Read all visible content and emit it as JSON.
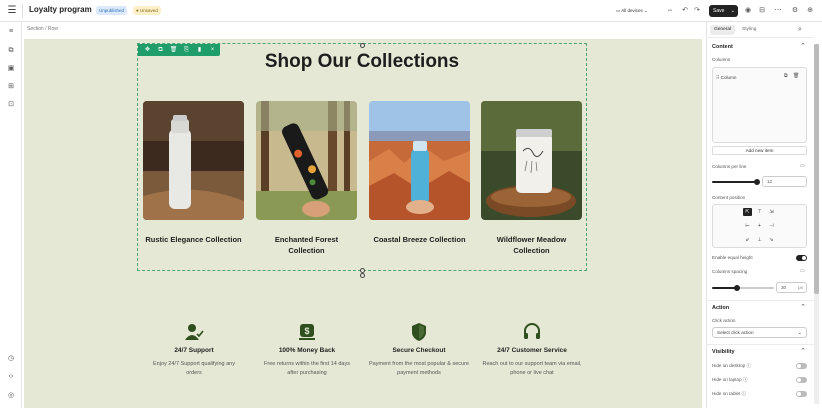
{
  "header": {
    "title": "Loyalty program",
    "status_published": "Unpublished",
    "status_saved": "Unsaved",
    "device_select": "All devices",
    "save_label": "Save"
  },
  "breadcrumb": {
    "part1": "Section",
    "sep": "/",
    "part2": "Row"
  },
  "canvas": {
    "heading": "Shop Our Collections",
    "collections": [
      {
        "title": "Rustic Elegance Collection"
      },
      {
        "title": "Enchanted Forest Collection"
      },
      {
        "title": "Coastal Breeze Collection"
      },
      {
        "title": "Wildflower Meadow Collection"
      }
    ],
    "features": [
      {
        "title": "24/7 Support",
        "desc": "Enjoy 24/7 Support qualifying any orders",
        "icon": "support-agent-icon"
      },
      {
        "title": "100% Money Back",
        "desc": "Free returns within the first 14 days after purchasing",
        "icon": "money-back-icon"
      },
      {
        "title": "Secure Checkout",
        "desc": "Payment from the most popular & secure payment methods",
        "icon": "shield-icon"
      },
      {
        "title": "24/7 Customer Service",
        "desc": "Reach out to our support team via email, phone or live chat",
        "icon": "headset-icon"
      }
    ],
    "feature_icon_color": "#2f4f1e",
    "background": "#e4e8d5"
  },
  "panel": {
    "tab_general": "General",
    "tab_styling": "Styling",
    "content_heading": "Content",
    "columns_label": "Columns",
    "column_item": "Column",
    "add_new_item": "Add new item",
    "columns_per_line_label": "Columns per line",
    "columns_per_line_value": "12",
    "columns_per_line_level": 0.97,
    "content_position_label": "Content position",
    "enable_equal_height_label": "Enable equal height",
    "enable_equal_height": true,
    "columns_spacing_label": "Columns spacing",
    "columns_spacing_value": "30",
    "columns_spacing_unit": "px",
    "columns_spacing_level": 0.4,
    "action_heading": "Action",
    "click_action_label": "Click action",
    "click_action_placeholder": "Select click action",
    "visibility_heading": "Visibility",
    "hide_desktop": "Hide on desktop",
    "hide_laptop": "Hide on laptop",
    "hide_tablet": "Hide on tablet"
  }
}
